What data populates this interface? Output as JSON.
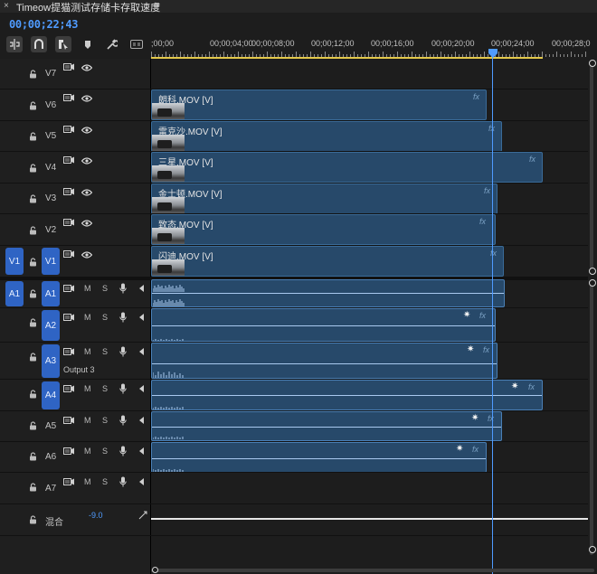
{
  "window": {
    "title": "Timeow提猫测试存储卡存取速度",
    "close": "×",
    "menu": "≡"
  },
  "timecode": "00;00;22;43",
  "toolbar": [
    "insert-sequence-icon",
    "snap-magnet-icon",
    "linked-selection-icon",
    "add-marker-icon",
    "wrench-icon",
    "captions-icon"
  ],
  "ruler": {
    "labels": [
      ";00;00",
      "00;00;04;00",
      "00;00;08;00",
      "00;00;12;00",
      "00;00;16;00",
      "00;00;20;00",
      "00;00;24;00",
      "00;00;28;0"
    ]
  },
  "video_tracks": [
    {
      "name": "V7",
      "clip": null
    },
    {
      "name": "V6",
      "clip": {
        "name": "朗科.MOV [V]",
        "fx": "fx"
      }
    },
    {
      "name": "V5",
      "clip": {
        "name": "雷克沙.MOV [V]",
        "fx": "fx"
      }
    },
    {
      "name": "V4",
      "clip": {
        "name": "三星.MOV [V]",
        "fx": "fx"
      }
    },
    {
      "name": "V3",
      "clip": {
        "name": "金士顿.MOV [V]",
        "fx": "fx"
      }
    },
    {
      "name": "V2",
      "clip": {
        "name": "致态.MOV [V]",
        "fx": "fx"
      }
    },
    {
      "name": "V1",
      "source": "V1",
      "clip": {
        "name": "闪迪.MOV [V]",
        "fx": "fx"
      }
    }
  ],
  "audio_tracks": [
    {
      "name": "A1",
      "source": "A1",
      "m": "M",
      "s": "S",
      "fx": "fx"
    },
    {
      "name": "A2",
      "m": "M",
      "s": "S",
      "fx": "fx"
    },
    {
      "name": "A3",
      "m": "M",
      "s": "S",
      "fx": "fx",
      "label": "Output 3"
    },
    {
      "name": "A4",
      "m": "M",
      "s": "S",
      "fx": "fx"
    },
    {
      "name": "A5",
      "m": "M",
      "s": "S",
      "fx": "fx"
    },
    {
      "name": "A6",
      "m": "M",
      "s": "S",
      "fx": "fx"
    },
    {
      "name": "A7",
      "m": "M",
      "s": "S"
    }
  ],
  "mix": {
    "label": "混合",
    "value": "-9.0"
  }
}
